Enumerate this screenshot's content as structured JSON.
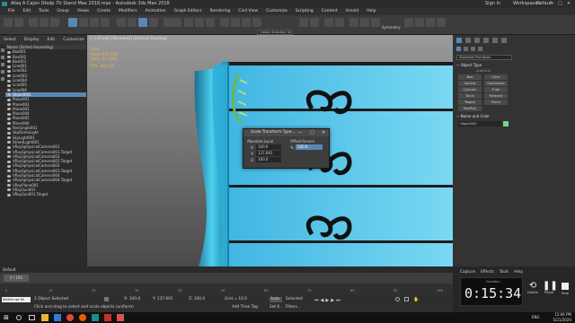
{
  "window_title": "Afaq A Cajon Otsdp 7Ir Stand Max 2018.max - Autodesk 3ds Max 2018",
  "sign_in": "Sign In",
  "workspaces": "Workspaces:",
  "workspace_value": "Default",
  "menu": [
    "File",
    "Edit",
    "Tools",
    "Group",
    "Views",
    "Create",
    "Modifiers",
    "Animation",
    "Graph Editors",
    "Rendering",
    "Civil View",
    "Customize",
    "Scripting",
    "Content",
    "Arnold",
    "Help"
  ],
  "toolbar": {
    "selection_set": "Create Selection Se",
    "symmetry": "Symmetry"
  },
  "scene_tabs": [
    "Select",
    "Display",
    "Edit",
    "Customize"
  ],
  "scene_header": "Name (Sorted Ascending)",
  "scene_items": [
    "Box001",
    "Box002",
    "Box003",
    "Line001",
    "Line002",
    "Line003",
    "Line004",
    "Line005",
    "Line006",
    "Object001",
    "Plane001",
    "Plane002",
    "Plane003",
    "Plane004",
    "Plane005",
    "Plane006",
    "Rectangle001",
    "SkyDomeLight",
    "SkyLight001",
    "StreetLight001",
    "VRaySphysicalCamera001",
    "VRaySphysicalCamera001.Target",
    "VRaySphysicalCamera002",
    "VRaySphysicalCamera002.Target",
    "VRaySphysicalCamera003",
    "VRaySphysicalCamera003.Target",
    "VRaySphysicalCamera004",
    "VRaySphysicalCamera004.Target",
    "VRayPlane001",
    "VRaySun001",
    "VRaySun001.Target"
  ],
  "scene_selected": 9,
  "viewport": {
    "label": "[+] [Front] [Standard] [Default Shading]",
    "stats_title": "Total",
    "polys": "Polys:  415,880",
    "verts": "Verts:  217,896",
    "fps": "FPS:   166.256"
  },
  "dialog": {
    "title": "Scale Transform Type...",
    "absolute": "Absolute:Local",
    "offset": "Offset:Screen",
    "x_label": "X:",
    "y_label": "Y:",
    "z_label": "Z:",
    "x_value": "100.0",
    "y_value": "137.691",
    "z_value": "100.0",
    "offset_value": "100.0"
  },
  "right_panel": {
    "dropdown": "Standard Primitives",
    "object_type": "Object Type",
    "autogrid": "AutoGrid",
    "buttons": [
      "Box",
      "Cone",
      "Sphere",
      "GeoSphere",
      "Cylinder",
      "Tube",
      "Torus",
      "Pyramid",
      "Teapot",
      "Plane",
      "TextPlus"
    ],
    "name_and_color": "Name and Color",
    "name_value": "Object002"
  },
  "layer": "Default",
  "frame_counter": "0 / 100",
  "timeline_ticks": [
    "0",
    "10",
    "20",
    "30",
    "40",
    "50",
    "60",
    "70",
    "80",
    "90",
    "100"
  ],
  "status": {
    "maxscript": "MAXScript Mi",
    "selected": "1 Object Selected",
    "hint": "Click and drag to select and scale objects (uniform)",
    "x": "X: 100.0",
    "y": "Y: 137.691",
    "z": "Z: 100.0",
    "grid": "Grid = 10.0",
    "add_time_tag": "Add Time Tag",
    "auto": "Auto",
    "selected_filter": "Selected",
    "set_key": "Set K.",
    "filters": "Filters..."
  },
  "ctrl": {
    "tabs": [
      "Capture",
      "Effects",
      "Tools",
      "Help"
    ],
    "duration_label": "Duration",
    "timer": "0:15:34",
    "delete": "Delete",
    "pause": "Pause",
    "stop": "Stop"
  },
  "taskbar": {
    "time": "12:06 PM",
    "date": "5/21/2020",
    "lang": "ENG"
  },
  "colors": {
    "cabinet": "#5ec4e6",
    "cabinet_dark": "#1f8fb8",
    "accent": "#5a87b4",
    "timer_bg": "#0e0e0e"
  }
}
